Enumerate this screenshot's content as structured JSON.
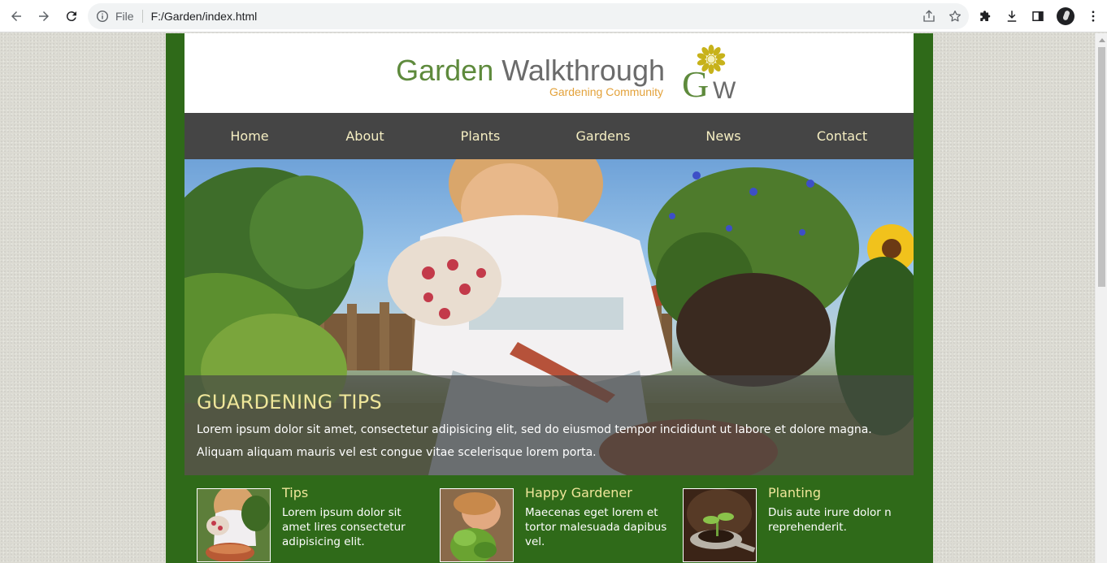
{
  "browser": {
    "scheme_label": "File",
    "url": "F:/Garden/index.html"
  },
  "site": {
    "title_part1": "Garden",
    "title_part2": "Walkthrough",
    "subtitle": "Gardening Community",
    "logo_text": "GW",
    "colors": {
      "page_background": "#2f6a19",
      "nav_background": "#454545",
      "nav_text": "#f5eec2",
      "heading_accent": "#efe69a",
      "title_green": "#5e8a3c",
      "subtitle_orange": "#e3a23b"
    }
  },
  "nav": [
    {
      "label": "Home"
    },
    {
      "label": "About"
    },
    {
      "label": "Plants"
    },
    {
      "label": "Gardens"
    },
    {
      "label": "News"
    },
    {
      "label": "Contact"
    }
  ],
  "hero": {
    "heading": "GUARDENING TIPS",
    "line1": "Lorem ipsum dolor sit amet, consectetur adipisicing elit, sed do eiusmod tempor incididunt ut labore et dolore magna.",
    "line2": "Aliquam aliquam mauris vel est congue vitae scelerisque lorem porta."
  },
  "features": [
    {
      "title": "Tips",
      "text": "Lorem ipsum dolor sit amet lires consectetur adipisicing elit."
    },
    {
      "title": "Happy Gardener",
      "text": "Maecenas eget lorem et tortor malesuada dapibus vel."
    },
    {
      "title": "Planting",
      "text": "Duis aute irure dolor n reprehenderit."
    }
  ]
}
